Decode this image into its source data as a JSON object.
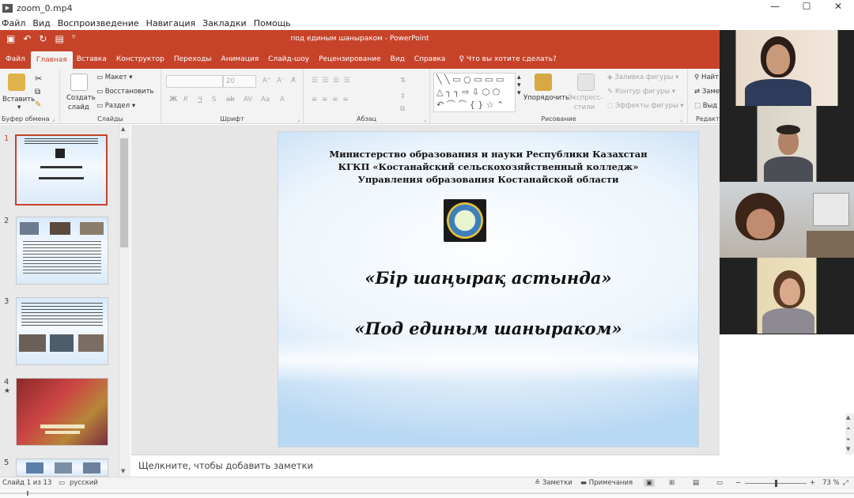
{
  "player": {
    "title": "zoom_0.mp4",
    "menu": [
      "Файл",
      "Вид",
      "Воспроизведение",
      "Навигация",
      "Закладки",
      "Помощь"
    ]
  },
  "ppt": {
    "window_title": "под единым шаныраком  -  PowerPoint",
    "tabs": [
      "Файл",
      "Главная",
      "Вставка",
      "Конструктор",
      "Переходы",
      "Анимация",
      "Слайд-шоу",
      "Рецензирование",
      "Вид",
      "Справка"
    ],
    "tell_me": "Что вы хотите сделать?",
    "ribbon": {
      "clipboard": {
        "label": "Буфер обмена",
        "paste": "Вставить"
      },
      "slides": {
        "label": "Слайды",
        "new_slide": "Создать",
        "new_slide_2": "слайд",
        "layout": "Макет",
        "reset": "Восстановить",
        "section": "Раздел"
      },
      "font": {
        "label": "Шрифт",
        "size": "20",
        "format_buttons": [
          "Ж",
          "К",
          "Ч",
          "S",
          "ab",
          "AV",
          "Aa"
        ]
      },
      "paragraph": {
        "label": "Абзац"
      },
      "drawing": {
        "label": "Рисование",
        "arrange": "Упорядочить",
        "quick_styles": "Экспресс-",
        "quick_styles_2": "стили",
        "fill": "Заливка фигуры",
        "outline": "Контур фигуры",
        "effects": "Эффекты фигуры"
      },
      "editing": {
        "label": "Редакти",
        "find": "Найт",
        "replace": "Заме",
        "select": "Выд"
      }
    },
    "thumb_numbers": [
      "1",
      "2",
      "3",
      "4",
      "5"
    ],
    "slide": {
      "header_lines": [
        "Министерство образования и науки Республики Казахстан",
        "КГКП «Костанайский сельскохозяйственный колледж»",
        "Управления образования Костанайской области"
      ],
      "title_kz": "«Бір шаңырақ астында»",
      "title_ru": "«Под единым шаныраком»"
    },
    "notes_placeholder": "Щелкните, чтобы добавить заметки",
    "status": {
      "slide_count": "Слайд 1 из 13",
      "language": "русский",
      "notes": "Заметки",
      "comments": "Примечания",
      "zoom": "73 %",
      "zoom_level": 0.5
    }
  },
  "colors": {
    "accent": "#c6432a",
    "ribbon_bg": "#f3f3f3"
  }
}
